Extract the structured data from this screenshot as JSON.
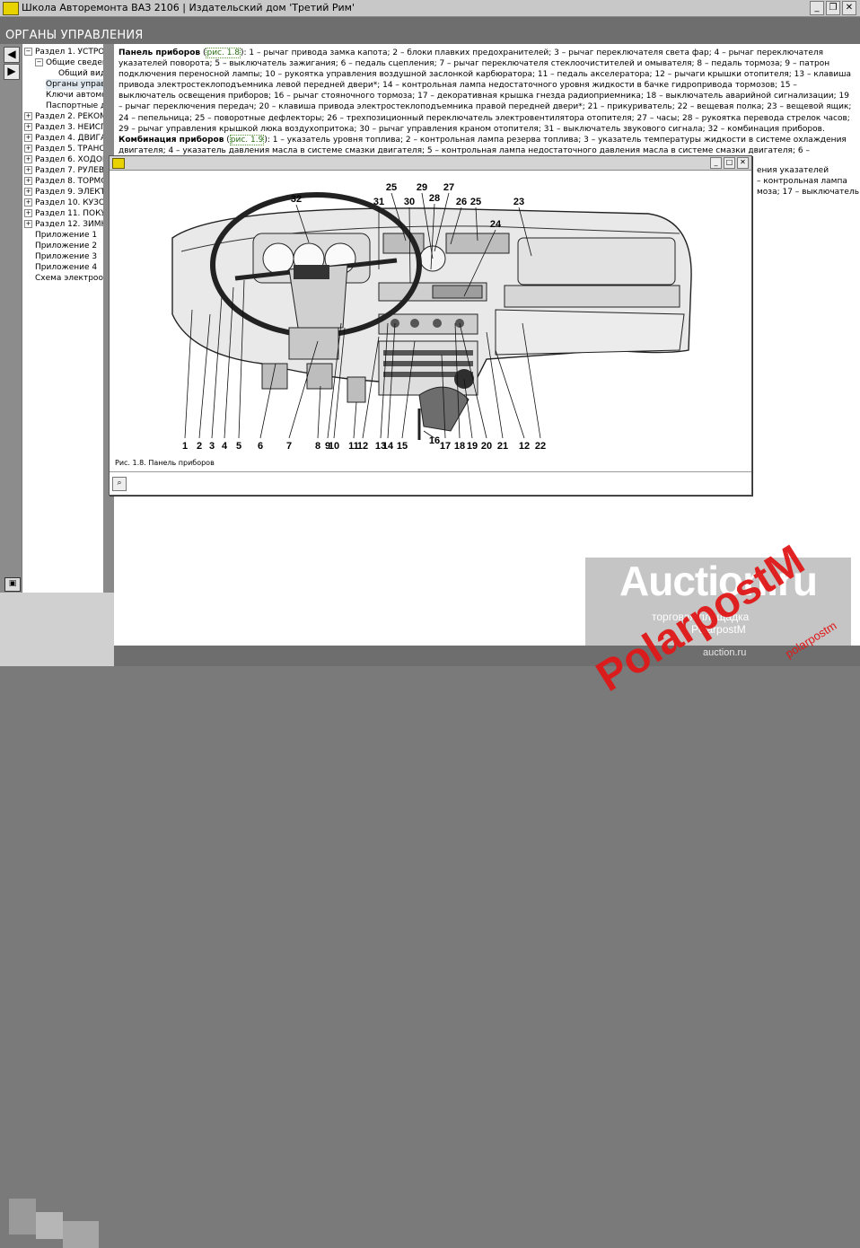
{
  "window": {
    "title": "Школа Авторемонта  ВАЗ 2106 | Издательский дом 'Третий Рим'",
    "minimize": "_",
    "restore": "❐",
    "close": "✕"
  },
  "section_title": "ОРГАНЫ УПРАВЛЕНИЯ",
  "nav": {
    "back": "◀",
    "forward": "▶"
  },
  "tree": [
    {
      "label": "Раздел 1. УСТРОЙ",
      "exp": "−"
    },
    {
      "label": "Общие сведен",
      "exp": "−"
    },
    {
      "label": "Общий вид",
      "exp": ""
    },
    {
      "label": "Органы управл",
      "exp": "",
      "selected": true
    },
    {
      "label": "Ключи автомоб",
      "exp": ""
    },
    {
      "label": "Паспортные да",
      "exp": ""
    },
    {
      "label": "Раздел 2. РЕКОМЕ",
      "exp": "+"
    },
    {
      "label": "Раздел 3. НЕИСПР",
      "exp": "+"
    },
    {
      "label": "Раздел 4. ДВИГАТ",
      "exp": "+"
    },
    {
      "label": "Раздел 5. ТРАНСМ",
      "exp": "+"
    },
    {
      "label": "Раздел 6. ХОДОВА",
      "exp": "+"
    },
    {
      "label": "Раздел 7. РУЛЕВО",
      "exp": "+"
    },
    {
      "label": "Раздел 8. ТОРМОЗ",
      "exp": "+"
    },
    {
      "label": "Раздел 9. ЭЛЕКТРИ",
      "exp": "+"
    },
    {
      "label": "Раздел 10. КУЗОВ",
      "exp": "+"
    },
    {
      "label": "Раздел 11. ПОКУП",
      "exp": "+"
    },
    {
      "label": "Раздел 12. ЗИМНЯ",
      "exp": "+"
    },
    {
      "label": "Приложение 1",
      "exp": ""
    },
    {
      "label": "Приложение 2",
      "exp": ""
    },
    {
      "label": "Приложение 3",
      "exp": ""
    },
    {
      "label": "Приложение 4",
      "exp": ""
    },
    {
      "label": "Схема электрообор",
      "exp": ""
    }
  ],
  "article": {
    "p1_head": "Панель приборов",
    "p1_open": " (",
    "p1_link": "рис. 1.8",
    "p1_text": "): 1 – рычаг привода замка капота; 2 – блоки плавких предохранителей; 3 – рычаг переключателя света фар; 4 – рычаг переключателя указателей поворота; 5 – выключатель зажигания; 6 – педаль сцепления; 7 – рычаг переключателя стеклоочистителей и омывателя; 8 – педаль тормоза; 9 – патрон подключения переносной лампы; 10 – рукоятка управления воздушной заслонкой карбюратора; 11 – педаль акселератора; 12 – рычаги крышки отопителя; 13 – клавиша привода электростеклоподъемника левой передней двери*; 14 – контрольная лампа недостаточного уровня жидкости в бачке гидропривода тормозов; 15 – выключатель освещения приборов; 16 – рычаг стояночного тормоза; 17 – декоративная крышка гнезда радиоприемника; 18 – выключатель аварийной сигнализации; 19 – рычаг переключения передач; 20 – клавиша привода электростеклоподъемника правой передней двери*; 21 – прикуриватель; 22 – вещевая полка; 23 – вещевой ящик; 24 – пепельница; 25 – поворотные дефлекторы; 26 – трехпозиционный переключатель электровентилятора отопителя; 27 – часы; 28 – рукоятка перевода стрелок часов; 29 – рычаг управления крышкой люка воздухопритока; 30 – рычаг управления краном отопителя; 31 – выключатель звукового сигнала; 32 – комбинация приборов.",
    "p2_head": "Комбинация приборов",
    "p2_open": " (",
    "p2_link": "рис. 1.9",
    "p2_text": "): 1 – указатель уровня топлива; 2 – контрольная лампа резерва топлива; 3 – указатель температуры жидкости в системе охлаждения двигателя; 4 – указатель давления масла в системе смазки двигателя; 5 – контрольная лампа недостаточного давления масла в системе смазки двигателя; 6 – спидометр; 7 – суточный",
    "peek1": "ения указателей",
    "peek2": "– контрольная лампа",
    "peek3": "моза; 17 – выключатель"
  },
  "popup": {
    "caption": "Рис. 1.8. Панель приборов",
    "min": "_",
    "max": "□",
    "close": "✕",
    "top_labels": [
      "32",
      "31",
      "30",
      "29",
      "28",
      "27",
      "26",
      "25",
      "24",
      "23",
      "25"
    ],
    "bottom_labels": [
      "1",
      "2",
      "3",
      "4",
      "5",
      "6",
      "7",
      "8",
      "9",
      "10",
      "11",
      "12",
      "13",
      "14",
      "15",
      "16",
      "17",
      "18",
      "19",
      "20",
      "21",
      "12",
      "22"
    ]
  },
  "watermark": {
    "brand": "Auction.ru",
    "tagline": "торговая площадка",
    "seller": "PolarpostM",
    "footer": "auction.ru",
    "red": "PolarpostM",
    "red_small": "polarpostm"
  }
}
